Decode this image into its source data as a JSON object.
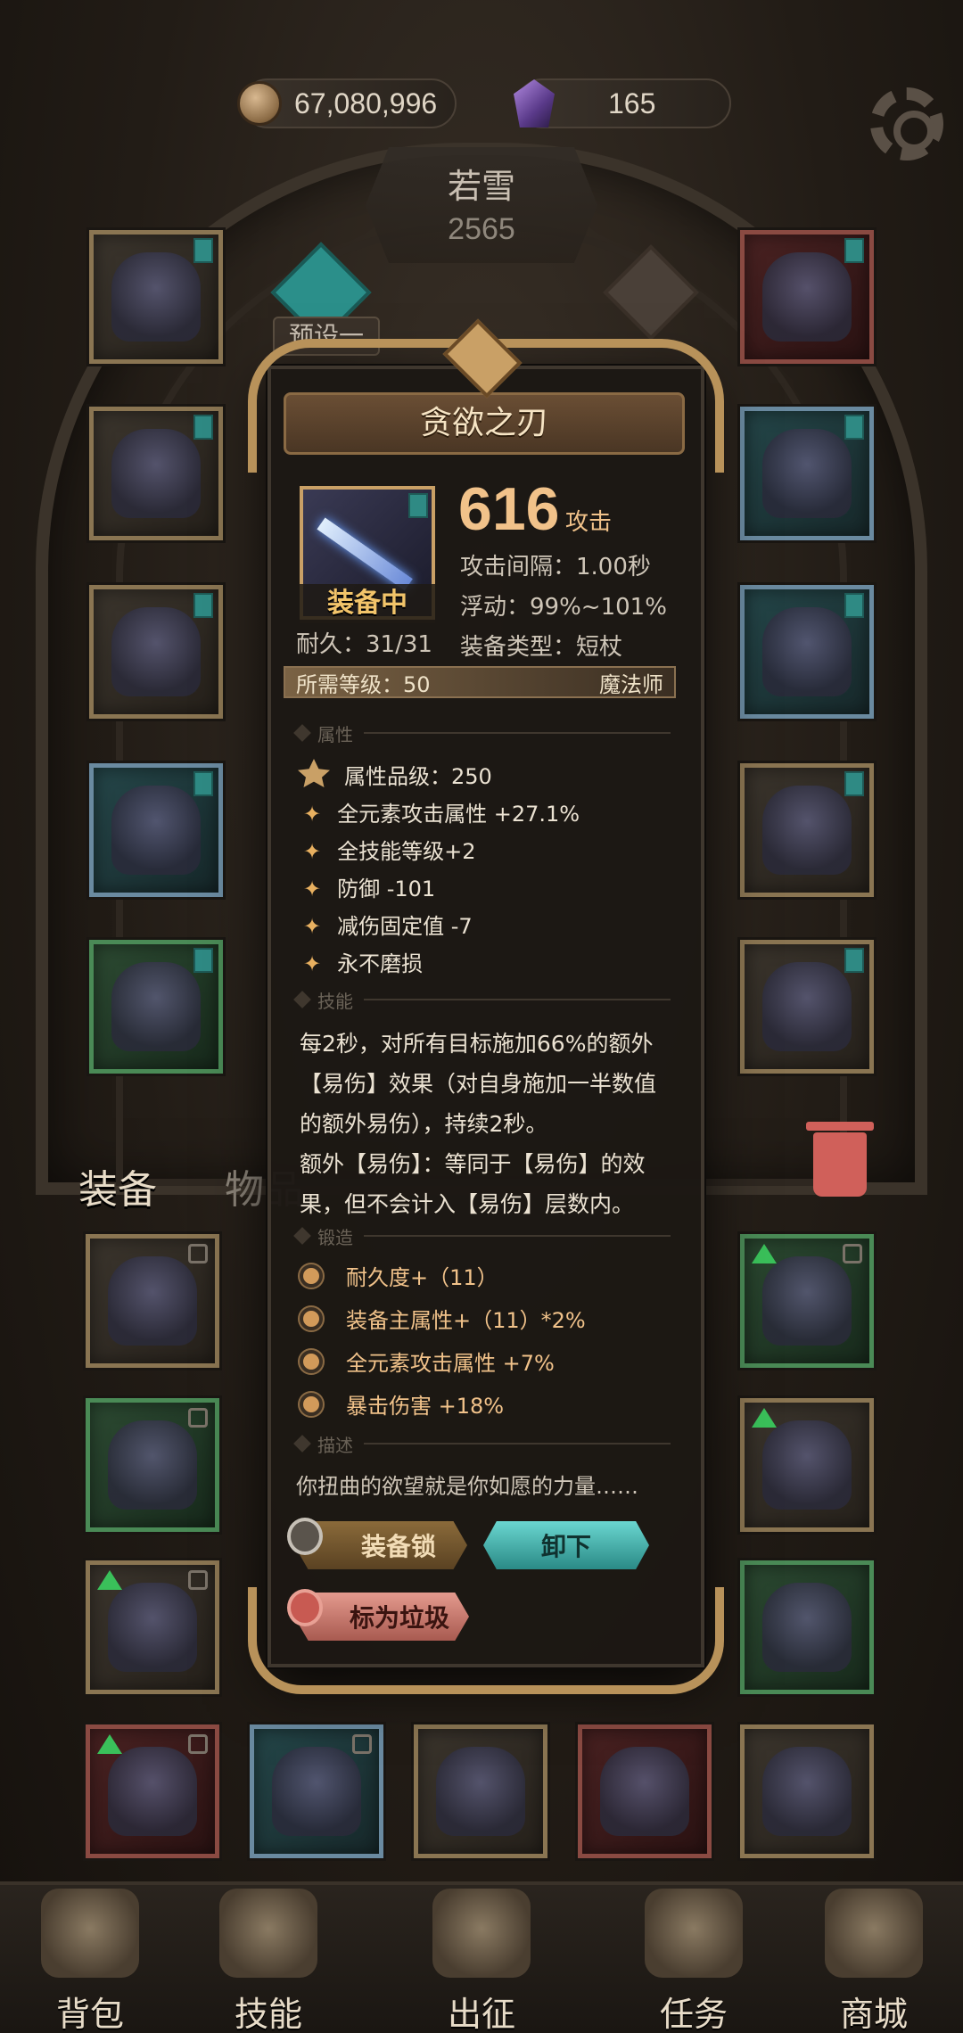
{
  "currency": {
    "gold": "67,080,996",
    "gems": "165",
    "gold_icon": "gold-coin-icon",
    "gem_icon": "purple-gem-icon"
  },
  "hero": {
    "name": "若雪",
    "power": "2565"
  },
  "preset": {
    "label": "预设一"
  },
  "tabs": {
    "equip": "装备",
    "items": "物品"
  },
  "nav": [
    {
      "label": "背包",
      "icon": "backpack-icon"
    },
    {
      "label": "技能",
      "icon": "skill-book-icon"
    },
    {
      "label": "出征",
      "icon": "expedition-icon"
    },
    {
      "label": "任务",
      "icon": "quest-icon"
    },
    {
      "label": "商城",
      "icon": "shop-icon"
    }
  ],
  "popup": {
    "title": "贪欲之刃",
    "equipped_badge": "装备中",
    "durability": "耐久：31/31",
    "attack_value": "616",
    "attack_label": "攻击",
    "attack_interval": "攻击间隔：1.00秒",
    "float": "浮动：99%~101%",
    "equip_type": "装备类型：短杖",
    "required_level": "所需等级：50",
    "class": "魔法师",
    "sections": {
      "attributes": "属性",
      "skill": "技能",
      "forge": "锻造",
      "description": "描述"
    },
    "attribute_grade": "属性品级：250",
    "attributes": [
      "全元素攻击属性 +27.1%",
      "全技能等级+2",
      "防御 -101",
      "减伤固定值 -7",
      "永不磨损"
    ],
    "skill_text": [
      "每2秒，对所有目标施加66%的额外",
      "【易伤】效果（对自身施加一半数值",
      "的额外易伤），持续2秒。",
      "额外【易伤】：等同于【易伤】的效",
      "果，但不会计入【易伤】层数内。"
    ],
    "forge": [
      "耐久度+（11）",
      "装备主属性+（11）*2%",
      "全元素攻击属性 +7%",
      "暴击伤害 +18%"
    ],
    "description": "你扭曲的欲望就是你如愿的力量……",
    "buttons": {
      "lock": "装备锁",
      "unequip": "卸下",
      "trash": "标为垃圾"
    }
  },
  "colors": {
    "gold_text": "#f1c28a",
    "teal_button": "#4ab8b2",
    "trash_button": "#d2786c"
  }
}
